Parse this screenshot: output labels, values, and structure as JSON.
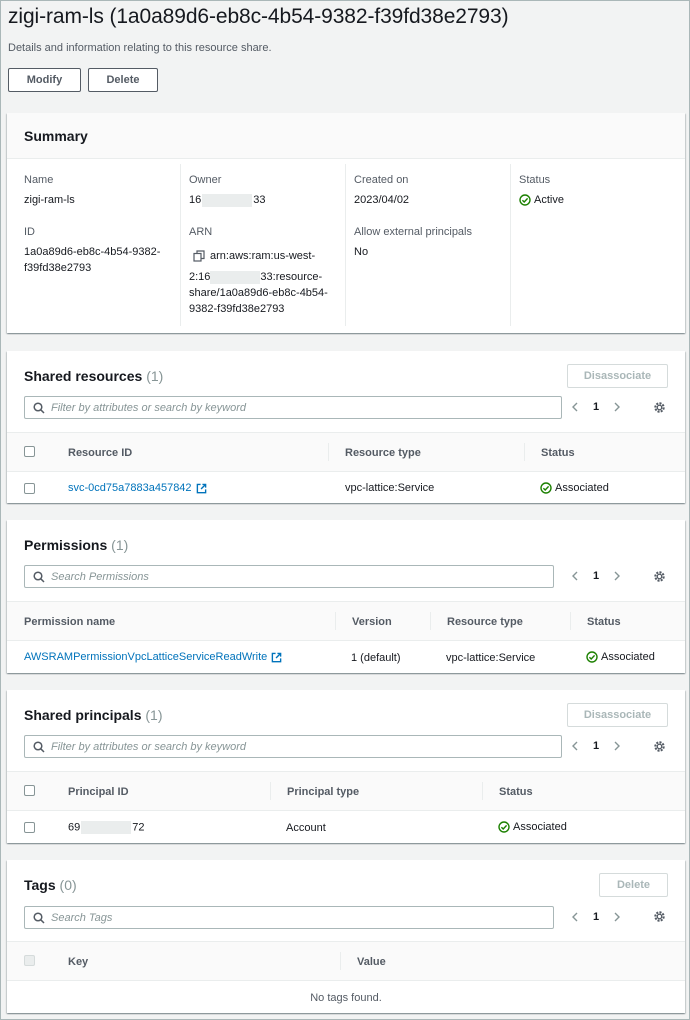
{
  "page": {
    "title": "zigi-ram-ls (1a0a89d6-eb8c-4b54-9382-f39fd38e2793)",
    "description": "Details and information relating to this resource share.",
    "modify_label": "Modify",
    "delete_label": "Delete"
  },
  "summary": {
    "title": "Summary",
    "name_label": "Name",
    "name_value": "zigi-ram-ls",
    "id_label": "ID",
    "id_value_line1": "1a0a89d6-eb8c-4b54-9382-",
    "id_value_line2": "f39fd38e2793",
    "owner_label": "Owner",
    "owner_prefix": "16",
    "owner_suffix": "33",
    "arn_label": "ARN",
    "arn_line1": "arn:aws:ram:us-west-",
    "arn_line2_prefix": "2:16",
    "arn_line2_suffix": "33:resource-",
    "arn_line3": "share/1a0a89d6-eb8c-4b54-",
    "arn_line4": "9382-f39fd38e2793",
    "created_label": "Created on",
    "created_value": "2023/04/02",
    "external_label": "Allow external principals",
    "external_value": "No",
    "status_label": "Status",
    "status_value": "Active"
  },
  "shared_resources": {
    "title": "Shared resources",
    "count": "(1)",
    "disassociate_label": "Disassociate",
    "search_placeholder": "Filter by attributes or search by keyword",
    "page": "1",
    "columns": [
      "Resource ID",
      "Resource type",
      "Status"
    ],
    "rows": [
      {
        "id": "svc-0cd75a7883a457842",
        "type": "vpc-lattice:Service",
        "status": "Associated"
      }
    ]
  },
  "permissions": {
    "title": "Permissions",
    "count": "(1)",
    "search_placeholder": "Search Permissions",
    "page": "1",
    "columns": [
      "Permission name",
      "Version",
      "Resource type",
      "Status"
    ],
    "rows": [
      {
        "name": "AWSRAMPermissionVpcLatticeServiceReadWrite",
        "version": "1 (default)",
        "type": "vpc-lattice:Service",
        "status": "Associated"
      }
    ]
  },
  "shared_principals": {
    "title": "Shared principals",
    "count": "(1)",
    "disassociate_label": "Disassociate",
    "search_placeholder": "Filter by attributes or search by keyword",
    "page": "1",
    "columns": [
      "Principal ID",
      "Principal type",
      "Status"
    ],
    "rows": [
      {
        "id_prefix": "69",
        "id_suffix": "72",
        "type": "Account",
        "status": "Associated"
      }
    ]
  },
  "tags": {
    "title": "Tags",
    "count": "(0)",
    "delete_label": "Delete",
    "search_placeholder": "Search Tags",
    "page": "1",
    "columns": [
      "Key",
      "Value"
    ],
    "empty_text": "No tags found."
  },
  "colors": {
    "link": "#0073bb",
    "success": "#1d8102",
    "text": "#16191f",
    "muted": "#545b64"
  }
}
